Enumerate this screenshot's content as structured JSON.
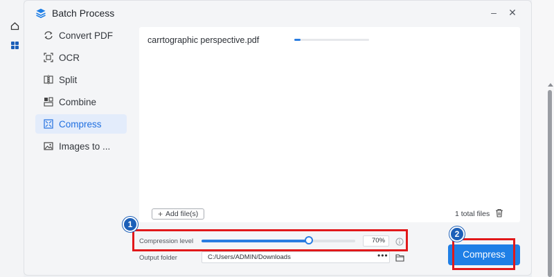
{
  "dialog": {
    "title": "Batch Process",
    "icon": "layers-icon",
    "window_buttons": [
      "minimize-icon",
      "close-icon"
    ]
  },
  "background_app": {
    "left_icons": [
      "home-icon",
      "grid-icon"
    ]
  },
  "sidebar": {
    "items": [
      {
        "label": "Convert PDF",
        "icon": "convert-icon",
        "active": false
      },
      {
        "label": "OCR",
        "icon": "ocr-icon",
        "active": false
      },
      {
        "label": "Split",
        "icon": "split-icon",
        "active": false
      },
      {
        "label": "Combine",
        "icon": "combine-icon",
        "active": false
      },
      {
        "label": "Compress",
        "icon": "compress-icon",
        "active": true
      },
      {
        "label": "Images to ...",
        "icon": "image-icon",
        "active": false
      }
    ]
  },
  "files": {
    "list": [
      {
        "name": "carrtographic perspective.pdf",
        "progress": 0.08
      }
    ],
    "add_label": "Add file(s)",
    "total_label": "1 total files"
  },
  "settings": {
    "compression_label": "Compression level",
    "compression_value": 0.7,
    "compression_display": "70%",
    "output_label": "Output folder",
    "output_path": "C:/Users/ADMIN/Downloads",
    "browse_label": "•••"
  },
  "compress_button": "Compress",
  "annotations": {
    "badge_1": "1",
    "badge_2": "2",
    "color": "#e1181a"
  },
  "colors": {
    "accent": "#1f7fe6",
    "active_bg": "#e3ecfb",
    "badge": "#1c5fb8"
  }
}
